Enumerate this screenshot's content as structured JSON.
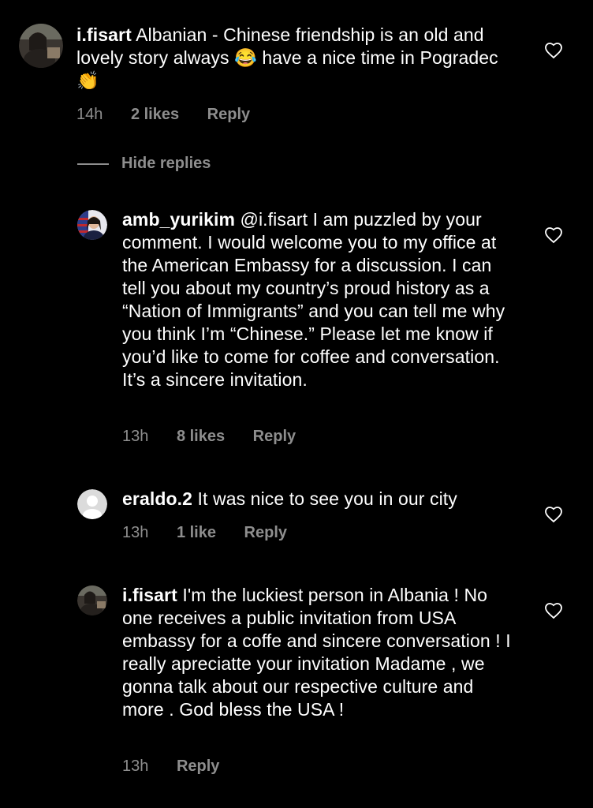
{
  "comments": [
    {
      "username": "i.fisart",
      "text": "Albanian - Chinese friendship is an old and lovely story always 😂 have a nice time in Pogradec 👏",
      "time": "14h",
      "likes": "2 likes",
      "reply": "Reply"
    },
    {
      "username": "amb_yurikim",
      "text": "@i.fisart I am puzzled by your comment. I would welcome you to my office at the American Embassy for a discussion. I can tell you about my country’s proud history as a “Nation of Immigrants” and you can tell me why you think I’m “Chinese.” Please let me know if you’d like to come for coffee and conversation. It’s a sincere invitation.",
      "time": "13h",
      "likes": "8 likes",
      "reply": "Reply"
    },
    {
      "username": "eraldo.2",
      "text": "It was nice to see you in our city",
      "time": "13h",
      "likes": "1 like",
      "reply": "Reply"
    },
    {
      "username": "i.fisart",
      "text": "I'm the luckiest person in Albania ! No one receives a public invitation from USA embassy for a coffe and sincere conversation ! I really apreciatte your invitation Madame , we gonna talk about our respective culture and more . God bless the USA !",
      "time": "13h",
      "reply": "Reply"
    }
  ],
  "hide_replies": "Hide replies",
  "icons": {
    "like": "heart-outline-icon"
  },
  "colors": {
    "background": "#000000",
    "text": "#ffffff",
    "muted": "#8e8e8e"
  }
}
